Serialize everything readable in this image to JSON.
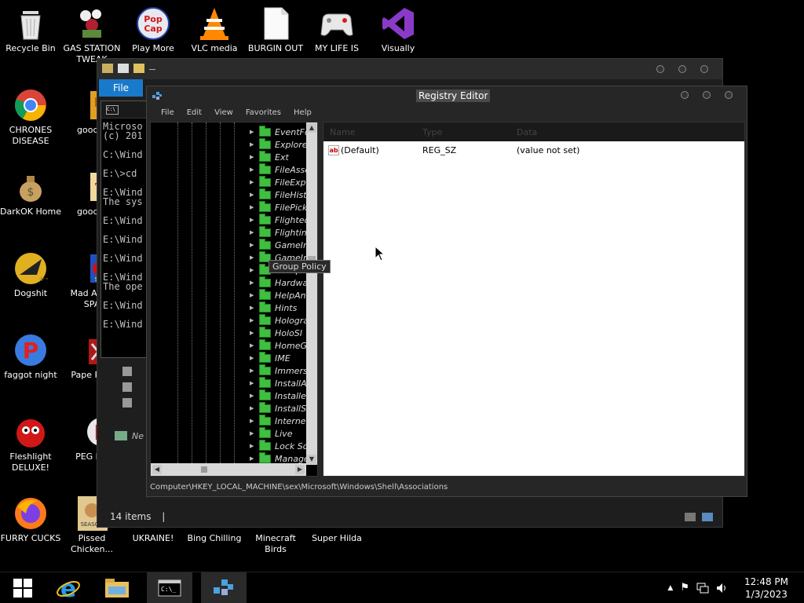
{
  "desktop_icons": [
    {
      "label": "Recycle Bin",
      "icon": "recycle-bin-icon"
    },
    {
      "label": "GAS STATION TWEAK",
      "icon": "flowers-icon"
    },
    {
      "label": "Play More",
      "icon": "popcap-icon"
    },
    {
      "label": "VLC media",
      "icon": "vlc-cone-icon"
    },
    {
      "label": "BURGIN OUT",
      "icon": "blank-file-icon"
    },
    {
      "label": "MY LIFE IS",
      "icon": "gamepad-icon"
    },
    {
      "label": "Visually",
      "icon": "visual-studio-icon"
    },
    {
      "label": "CHRONES DISEASE",
      "icon": "chrome-icon"
    },
    {
      "label": "good g",
      "icon": "book-icon"
    },
    {
      "label": "DarkOK Home",
      "icon": "money-bag-icon"
    },
    {
      "label": "good g",
      "icon": "book-red-icon"
    },
    {
      "label": "Dogshit",
      "icon": "dogshit-icon"
    },
    {
      "label": "Mad Av IN SPA",
      "icon": "angry-birds-icon"
    },
    {
      "label": "faggot night",
      "icon": "p-logo-icon"
    },
    {
      "label": "Pape Plea",
      "icon": "paper-icon"
    },
    {
      "label": "Fleshlight DELUXE!",
      "icon": "red-creature-icon"
    },
    {
      "label": "PEG MY",
      "icon": "peg-icon"
    },
    {
      "label": "FURRY CUCKS",
      "icon": "firefox-icon"
    },
    {
      "label": "Pissed Chicken...",
      "icon": "chicken-icon"
    },
    {
      "label": "UKRAINE!",
      "icon": "ukraine-icon"
    },
    {
      "label": "Bing Chilling",
      "icon": "bing-icon"
    },
    {
      "label": "Minecraft Birds",
      "icon": "minecraft-icon"
    },
    {
      "label": "Super Hilda",
      "icon": "hilda-icon"
    }
  ],
  "explorer": {
    "file_tab": "File",
    "status_items": "14 items",
    "status_sep": "|",
    "nav_partial": "Ne"
  },
  "cmd": {
    "lines": [
      "Microso",
      "(c) 201",
      "",
      "C:\\Wind",
      "",
      "E:\\>cd",
      "",
      "E:\\Wind",
      "The sys",
      "",
      "E:\\Wind",
      "",
      "E:\\Wind",
      "",
      "E:\\Wind",
      "",
      "E:\\Wind",
      "The ope",
      "",
      "E:\\Wind",
      "",
      "E:\\Wind"
    ]
  },
  "regedit": {
    "title": "Registry Editor",
    "menu": [
      "File",
      "Edit",
      "View",
      "Favorites",
      "Help"
    ],
    "tree_items": [
      "EventFo",
      "Explorer",
      "Ext",
      "FileAsso",
      "FileExpl",
      "FileHist",
      "FilePick",
      "Flighted",
      "Flighting",
      "GameIn",
      "GameIn",
      "Group Policy",
      "Hardwa",
      "HelpAnd",
      "Hints",
      "Hologra",
      "HoloSI",
      "HomeGr",
      "IME",
      "Immers",
      "InstallA",
      "Installer",
      "InstallSe",
      "Internet",
      "Live",
      "Lock Scr",
      "Manage"
    ],
    "tooltip": "Group Policy",
    "columns": [
      "Name",
      "Type",
      "Data"
    ],
    "values": [
      {
        "name": "(Default)",
        "type": "REG_SZ",
        "data": "(value not set)"
      }
    ],
    "status_path": "Computer\\HKEY_LOCAL_MACHINE\\sex\\Microsoft\\Windows\\Shell\\Associations"
  },
  "taskbar": {
    "items": [
      "start-button",
      "internet-explorer",
      "file-explorer",
      "command-prompt",
      "registry-editor"
    ],
    "time": "12:48 PM",
    "date": "1/3/2023"
  }
}
